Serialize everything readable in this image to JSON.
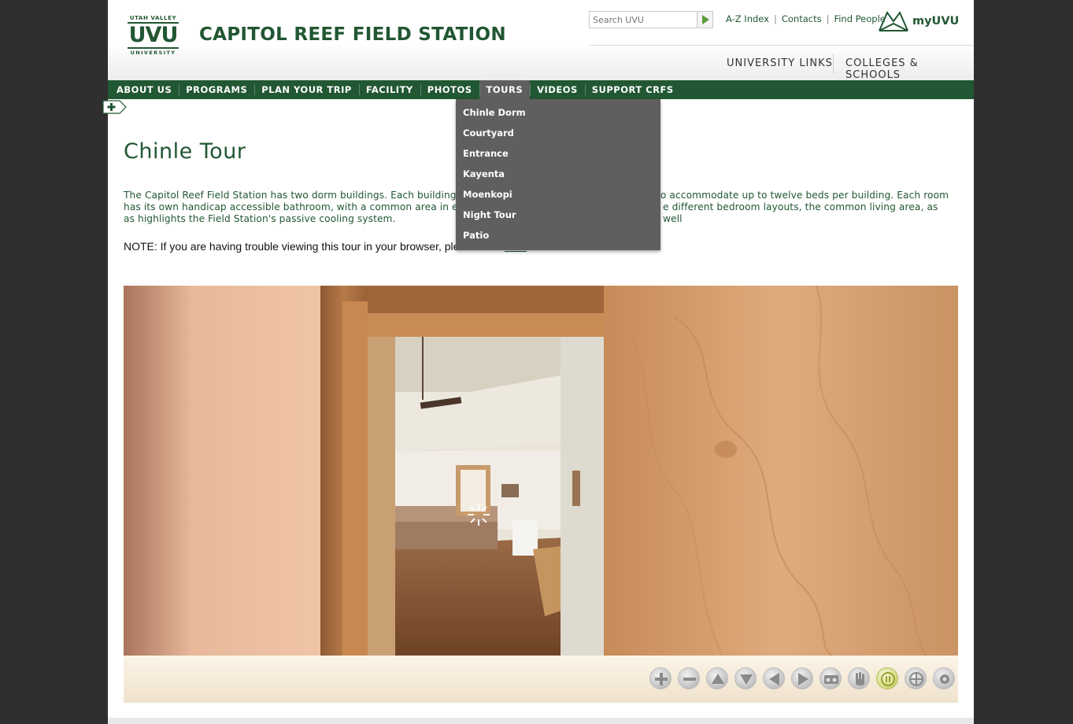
{
  "header": {
    "logo": {
      "top": "UTAH VALLEY",
      "mid": "UVU",
      "bottom": "UNIVERSITY"
    },
    "site_title": "CAPITOL REEF FIELD STATION",
    "search": {
      "placeholder": "Search UVU"
    },
    "top_links": [
      "A-Z Index",
      "Contacts",
      "Find People"
    ],
    "top_link_separator": "|",
    "myuvu_label": "myUVU",
    "university_links": "UNIVERSITY LINKS",
    "colleges_schools": "COLLEGES & SCHOOLS"
  },
  "nav": {
    "items": [
      "ABOUT US",
      "PROGRAMS",
      "PLAN YOUR TRIP",
      "FACILITY",
      "PHOTOS",
      "TOURS",
      "VIDEOS",
      "SUPPORT CRFS"
    ],
    "active": "TOURS",
    "tours_dropdown": [
      "Chinle Dorm",
      "Courtyard",
      "Entrance",
      "Kayenta",
      "Moenkopi",
      "Night Tour",
      "Patio"
    ]
  },
  "main": {
    "title": "Chinle Tour",
    "intro_visible_left": "The Capitol Reef Field Station has two dorm buildings. Each building",
    "intro_line1_right": "to accommodate up to twelve beds per building. Each room",
    "intro_line2_left": "has its own handicap accessible bathroom, with a common area in e",
    "intro_line2_right": "e different bedroom layouts, the common living area, as well",
    "intro_line3": "as highlights the Field Station's passive cooling system.",
    "note_text": "NOTE: If you are having trouble viewing this tour in your browser, ple",
    "note_link": "here"
  },
  "tour_controls": [
    "zoom-in",
    "zoom-out",
    "up",
    "down",
    "left",
    "right",
    "vr",
    "drag-hand",
    "autorotate-pause",
    "gyro",
    "fullscreen"
  ],
  "colors": {
    "brand_green": "#215732",
    "dropdown_bg": "#5f5f5f",
    "page_bg": "#2f2f2f"
  }
}
